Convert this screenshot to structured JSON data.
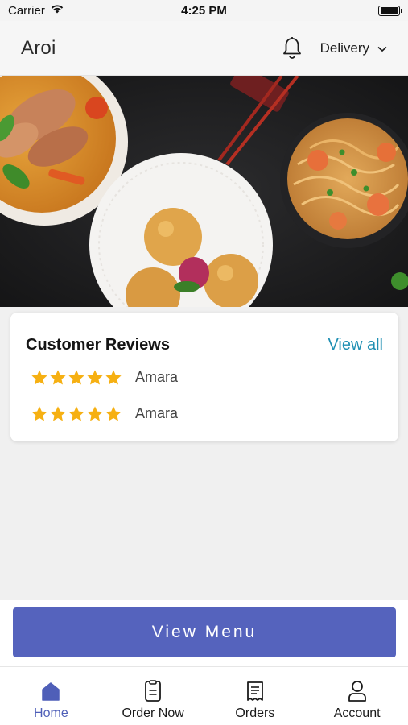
{
  "status_bar": {
    "carrier": "Carrier",
    "time": "4:25 PM"
  },
  "header": {
    "title": "Aroi",
    "icon": "bell-icon",
    "delivery_label": "Delivery"
  },
  "reviews": {
    "title": "Customer Reviews",
    "view_all_label": "View all",
    "items": [
      {
        "reviewer": "Amara",
        "rating": 5
      },
      {
        "reviewer": "Amara",
        "rating": 5
      }
    ]
  },
  "actions": {
    "view_menu_label": "View Menu"
  },
  "tab_bar": {
    "items": [
      {
        "label": "Home",
        "icon": "home-icon",
        "active": true
      },
      {
        "label": "Order Now",
        "icon": "order-now-icon",
        "active": false
      },
      {
        "label": "Orders",
        "icon": "orders-icon",
        "active": false
      },
      {
        "label": "Account",
        "icon": "account-icon",
        "active": false
      }
    ]
  },
  "colors": {
    "accent": "#5563bd",
    "active_tab": "#4f5fb8",
    "link": "#1f8fb3",
    "star": "#f6b012"
  }
}
